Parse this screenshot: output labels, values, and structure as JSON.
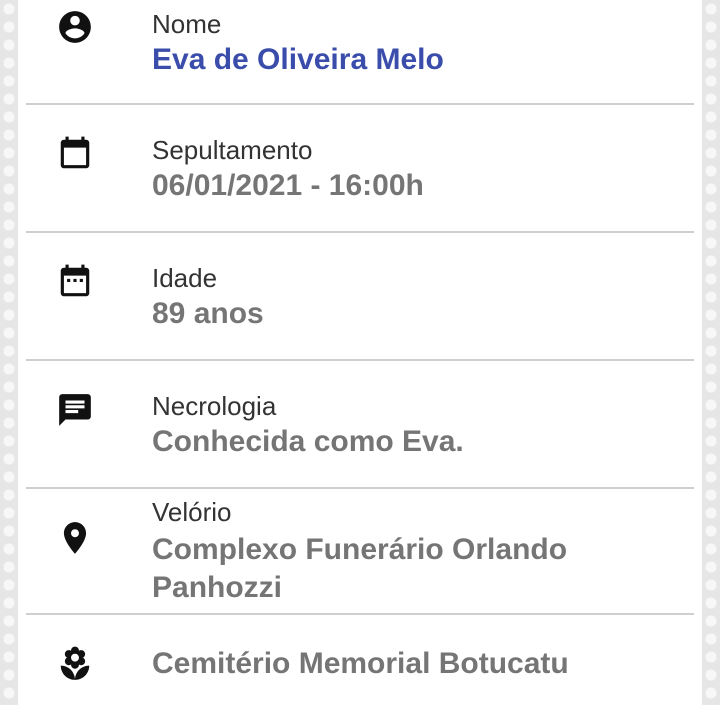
{
  "rows": [
    {
      "label": "Nome",
      "value": "Eva de Oliveira Melo",
      "icon": "account-circle-icon"
    },
    {
      "label": "Sepultamento",
      "value": "06/01/2021 - 16:00h",
      "icon": "calendar-icon"
    },
    {
      "label": "Idade",
      "value": "89 anos",
      "icon": "calendar-dots-icon"
    },
    {
      "label": "Necrologia",
      "value": "Conhecida como Eva.",
      "icon": "message-icon"
    },
    {
      "label": "Velório",
      "value": "Complexo Funerário Orlando Panhozzi",
      "icon": "map-pin-icon"
    },
    {
      "label": "",
      "value": "Cemitério Memorial Botucatu",
      "icon": "flower-icon"
    }
  ],
  "colors": {
    "name": "#3a4dab",
    "value": "#757575",
    "label": "#333333",
    "divider": "#cfcfcf"
  }
}
